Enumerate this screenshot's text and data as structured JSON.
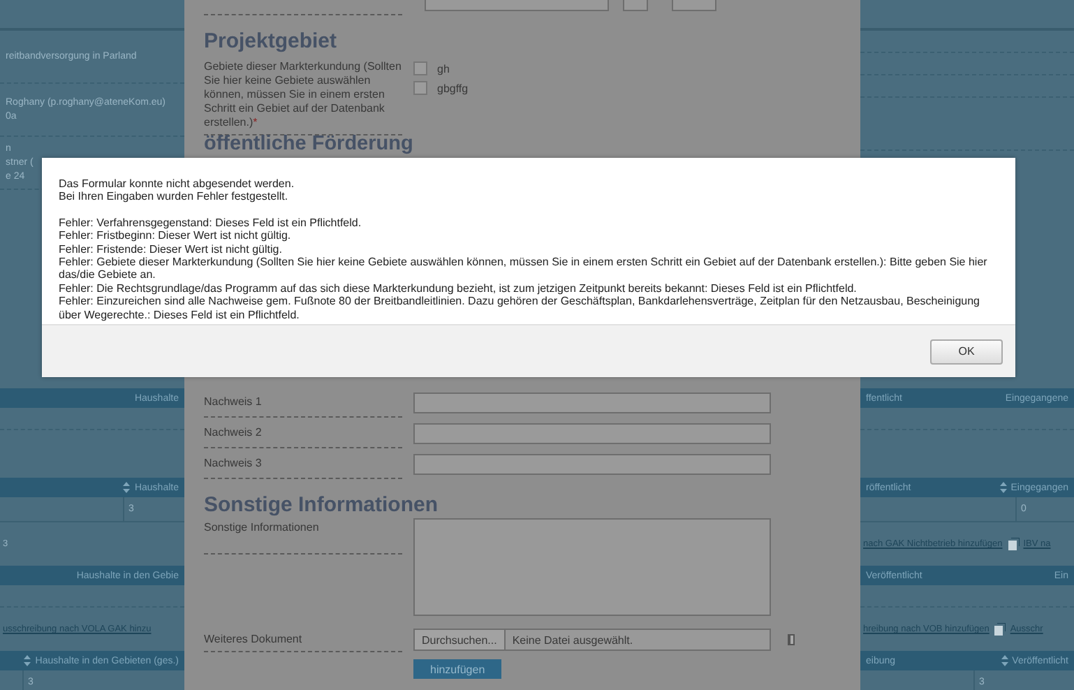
{
  "left_panel": {
    "upper": [
      {
        "kind": "top"
      },
      {
        "kind": "row",
        "lines": [
          "reitbandversorgung in Parland"
        ]
      },
      {
        "kind": "row",
        "lines": [
          "Roghany (p.roghany@ateneKom.eu)",
          "0a"
        ]
      },
      {
        "kind": "row",
        "lines": [
          "n",
          "stner (",
          "e 24"
        ]
      }
    ],
    "lower": [
      {
        "kind": "header",
        "cells": [
          {
            "text": "Haushalte",
            "sortable": false
          }
        ]
      },
      {
        "kind": "empty"
      },
      {
        "kind": "gap"
      },
      {
        "kind": "header",
        "cells": [
          {
            "text": "Haushalte",
            "sortable": true
          }
        ]
      },
      {
        "kind": "cell",
        "value": "3"
      },
      {
        "kind": "links",
        "items": [
          {
            "kind": "note",
            "text": "3"
          }
        ]
      },
      {
        "kind": "header",
        "cells": [
          {
            "text": "Haushalte in den Gebie",
            "sortable": false
          }
        ]
      },
      {
        "kind": "empty"
      },
      {
        "kind": "links",
        "items": [
          {
            "kind": "link",
            "text": "usschreibung nach VOLA GAK hinzu"
          }
        ]
      },
      {
        "kind": "header",
        "cells": [
          {
            "text": "Haushalte in den Gebieten (ges.)",
            "sortable": true
          }
        ]
      },
      {
        "kind": "cell",
        "value": "3"
      }
    ]
  },
  "form": {
    "projektgebiet": {
      "heading": "Projektgebiet",
      "label": "Gebiete dieser Markterkundung (Sollten Sie hier keine Gebiete auswählen können, müssen Sie in einem ersten Schritt ein Gebiet auf der Datenbank erstellen.)",
      "required_mark": "*",
      "options": [
        {
          "label": "gh",
          "checked": false
        },
        {
          "label": "gbgffg",
          "checked": false
        }
      ]
    },
    "foerderung_heading": "öffentliche Förderung",
    "nachweise": [
      {
        "label": "Nachweis 1"
      },
      {
        "label": "Nachweis 2"
      },
      {
        "label": "Nachweis 3"
      }
    ],
    "sonstige": {
      "heading": "Sonstige Informationen",
      "label": "Sonstige Informationen"
    },
    "dokument": {
      "label": "Weiteres Dokument",
      "browse_button": "Durchsuchen...",
      "file_status": "Keine Datei ausgewählt.",
      "add_button": "hinzufügen"
    }
  },
  "right_panel": {
    "upper": [
      {
        "kind": "top"
      },
      {
        "kind": "empty"
      },
      {
        "kind": "empty"
      },
      {
        "kind": "empty"
      },
      {
        "kind": "row"
      }
    ],
    "lower": [
      {
        "kind": "header",
        "cells": [
          {
            "text": "ffentlicht",
            "sortable": false
          },
          {
            "text": "Eingegangene",
            "sortable": false
          }
        ]
      },
      {
        "kind": "empty"
      },
      {
        "kind": "gap"
      },
      {
        "kind": "header",
        "cells": [
          {
            "text": "röffentlicht",
            "sortable": false
          },
          {
            "text": "Eingegangen",
            "sortable": true
          }
        ]
      },
      {
        "kind": "cell",
        "value": "0"
      },
      {
        "kind": "links",
        "items": [
          {
            "kind": "link",
            "text": "nach GAK Nichtbetrieb hinzufügen"
          },
          {
            "kind": "icon_link",
            "text": "IBV na"
          }
        ]
      },
      {
        "kind": "header",
        "cells": [
          {
            "text": "Veröffentlicht",
            "sortable": false
          },
          {
            "text": "Ein",
            "sortable": false
          }
        ]
      },
      {
        "kind": "empty"
      },
      {
        "kind": "links",
        "items": [
          {
            "kind": "link",
            "text": "hreibung nach VOB hinzufügen"
          },
          {
            "kind": "icon_link",
            "text": "Ausschr"
          }
        ]
      },
      {
        "kind": "header",
        "cells": [
          {
            "text": "eibung",
            "sortable": false
          },
          {
            "text": "Veröffentlicht",
            "sortable": true
          }
        ]
      },
      {
        "kind": "cell",
        "value": "3"
      }
    ]
  },
  "dialog": {
    "intro": [
      "Das Formular konnte nicht abgesendet werden.",
      "Bei Ihren Eingaben wurden Fehler festgestellt."
    ],
    "errors": [
      "Fehler: Verfahrensgegenstand: Dieses Feld ist ein Pflichtfeld.",
      "Fehler: Fristbeginn: Dieser Wert ist nicht gültig.",
      "Fehler: Fristende: Dieser Wert ist nicht gültig.",
      "Fehler: Gebiete dieser Markterkundung (Sollten Sie hier keine Gebiete auswählen können, müssen Sie in einem ersten Schritt ein Gebiet auf der Datenbank erstellen.): Bitte geben Sie hier das/die Gebiete an.",
      "Fehler: Die Rechtsgrundlage/das Programm auf das sich diese Markterkundung bezieht, ist zum jetzigen Zeitpunkt bereits bekannt: Dieses Feld ist ein Pflichtfeld.",
      "Fehler: Einzureichen sind alle Nachweise gem. Fußnote 80 der Breitbandleitlinien. Dazu gehören der Geschäftsplan, Bankdarlehensverträge, Zeitplan für den Netzausbau, Bescheinigung über Wegerechte.: Dieses Feld ist ein Pflichtfeld."
    ],
    "ok_button": "OK"
  }
}
